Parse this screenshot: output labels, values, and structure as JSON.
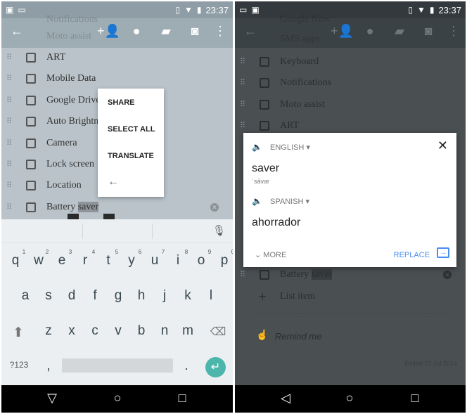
{
  "status": {
    "time": "23:37"
  },
  "left": {
    "ghost_rows": [
      "Notifications",
      "Moto assist"
    ],
    "items": [
      "ART",
      "Mobile Data",
      "Google Drive",
      "Auto Brightness",
      "Camera",
      "Lock screen",
      "Location",
      "Battery saver"
    ],
    "selection": "saver",
    "menu": {
      "share": "SHARE",
      "select_all": "SELECT ALL",
      "translate": "TRANSLATE"
    },
    "keyboard": {
      "row1": [
        "q",
        "w",
        "e",
        "r",
        "t",
        "y",
        "u",
        "i",
        "o",
        "p"
      ],
      "hints": [
        "1",
        "2",
        "3",
        "4",
        "5",
        "6",
        "7",
        "8",
        "9",
        "0"
      ],
      "row2": [
        "a",
        "s",
        "d",
        "f",
        "g",
        "h",
        "j",
        "k",
        "l"
      ],
      "row3": [
        "z",
        "x",
        "c",
        "v",
        "b",
        "n",
        "m"
      ],
      "symbols": "?123",
      "comma": ",",
      "period": "."
    }
  },
  "right": {
    "ghost_rows": [
      "Google Now",
      "SMS apps"
    ],
    "items": [
      "Keyboard",
      "Notifications",
      "Moto assist",
      "ART"
    ],
    "last_item": "Battery saver",
    "add_item": "List item",
    "remind": "Remind me",
    "edited": "Edited 27 Jul 2014",
    "translate": {
      "source_lang": "ENGLISH",
      "source_word": "saver",
      "phonetic": "ˈsāvər",
      "target_lang": "SPANISH",
      "target_word": "ahorrador",
      "more": "MORE",
      "replace": "REPLACE",
      "accent": "#4a8ef0"
    }
  }
}
